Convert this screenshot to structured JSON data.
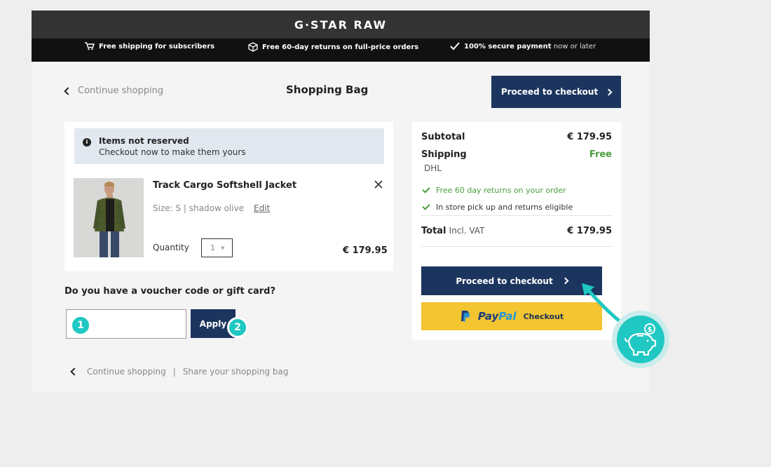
{
  "header": {
    "logo": "G·STAR RAW",
    "usps": [
      {
        "icon": "cart-icon",
        "bold": "Free shipping for subscribers",
        "rest": ""
      },
      {
        "icon": "box-icon",
        "bold": "Free 60-day returns on full-price orders",
        "rest": ""
      },
      {
        "icon": "check-icon",
        "bold": "100% secure payment",
        "rest": " now or later"
      }
    ]
  },
  "nav": {
    "continue_shopping": "Continue shopping",
    "page_title": "Shopping Bag",
    "checkout_label": "Proceed to checkout"
  },
  "notice": {
    "title": "Items not reserved",
    "subtitle": "Checkout now to make them yours"
  },
  "cart": {
    "items": [
      {
        "name": "Track Cargo Softshell Jacket",
        "size_color": "Size: S | shadow olive",
        "edit_label": "Edit",
        "quantity_label": "Quantity",
        "quantity": "1",
        "price": "€ 179.95"
      }
    ]
  },
  "voucher": {
    "question": "Do you have a voucher code or gift card?",
    "apply_label": "Apply",
    "input_value": ""
  },
  "steps": [
    "1",
    "2"
  ],
  "footer_links": {
    "continue_shopping": "Continue shopping",
    "separator": "|",
    "share": "Share your shopping bag"
  },
  "summary": {
    "subtitle_label": "Subtotal",
    "subtotal": "€ 179.95",
    "shipping_label": "Shipping",
    "shipping_value": "Free",
    "carrier": "DHL",
    "benefits": [
      "Free 60 day returns on your order",
      "In store pick up and returns eligible"
    ],
    "total_label": "Total",
    "total_suffix": "Incl. VAT",
    "total": "€ 179.95",
    "checkout_label": "Proceed to checkout",
    "paypal_pay": "Pay",
    "paypal_pal": "Pal",
    "paypal_checkout": "Checkout"
  },
  "colors": {
    "navy": "#1c355e",
    "teal_accent": "#1fc8c2",
    "paypal_yellow": "#f2c531",
    "success_green": "#4a9c3e"
  }
}
